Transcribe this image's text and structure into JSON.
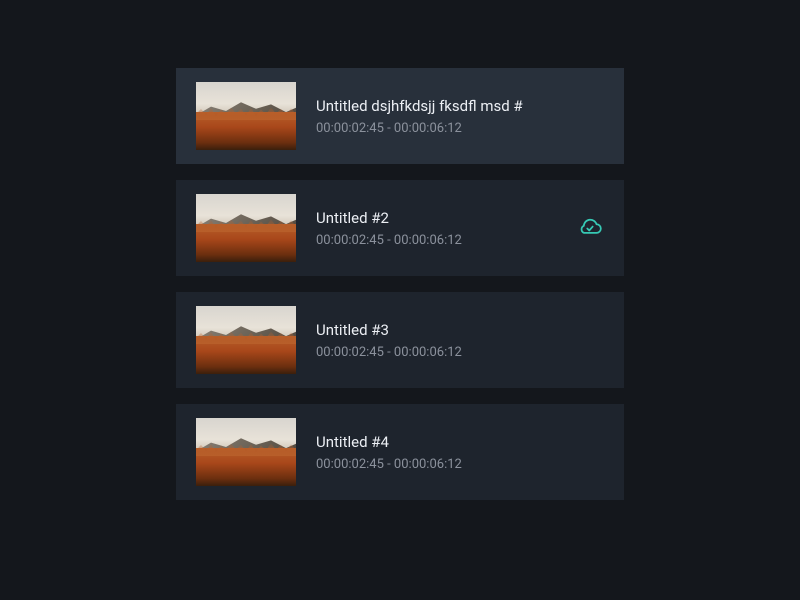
{
  "clips": [
    {
      "title": "Untitled dsjhfkdsjj fksdfl msd #",
      "timecode": "00:00:02:45 - 00:00:06:12",
      "selected": true,
      "synced": false
    },
    {
      "title": "Untitled #2",
      "timecode": "00:00:02:45 - 00:00:06:12",
      "selected": false,
      "synced": true
    },
    {
      "title": "Untitled #3",
      "timecode": "00:00:02:45 - 00:00:06:12",
      "selected": false,
      "synced": false
    },
    {
      "title": "Untitled #4",
      "timecode": "00:00:02:45 - 00:00:06:12",
      "selected": false,
      "synced": false
    }
  ],
  "colors": {
    "accent": "#36c9b4"
  }
}
